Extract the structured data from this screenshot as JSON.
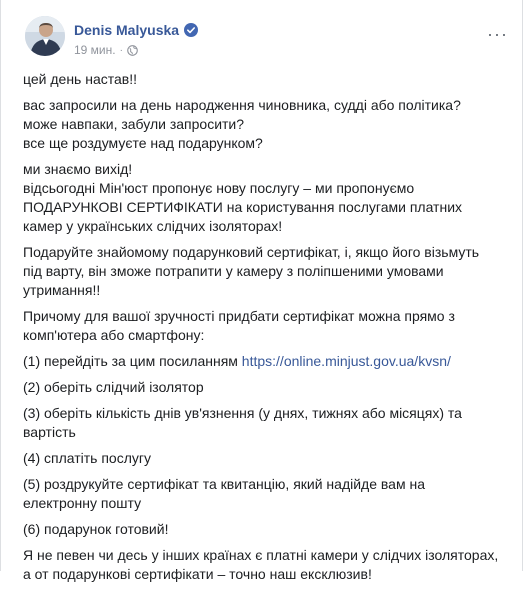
{
  "post": {
    "author": "Denis Malyuska",
    "time": "19 мин.",
    "more_label": "···",
    "paragraphs": [
      [
        "цей день настав!!"
      ],
      [
        "вас запросили на день народження чиновника, судді або політика?",
        "може навпаки, забули запросити?",
        "все ще роздумуєте над подарунком?"
      ],
      [
        "ми знаємо вихід!",
        "відсьогодні Мін'юст пропонує нову послугу – ми пропонуємо",
        "ПОДАРУНКОВІ СЕРТИФІКАТИ на користування послугами платних",
        "камер у українських слідчих ізоляторах!"
      ],
      [
        "Подаруйте знайомому подарунковий сертифікат, і, якщо його візьмуть",
        "під варту, він зможе потрапити у камеру з поліпшеними умовами",
        "утримання!!"
      ],
      [
        "Причому для вашої зручності придбати сертифікат можна прямо з",
        "комп'ютера або смартфону:"
      ]
    ],
    "step1_text": "(1) перейдіть за цим посиланням ",
    "step1_link": "https://online.minjust.gov.ua/kvsn/",
    "steps": [
      [
        "(2) оберіть слідчий ізолятор"
      ],
      [
        "(3) оберіть кількість днів ув'язнення (у днях, тижнях або місяцях) та",
        "вартість"
      ],
      [
        "(4) сплатіть послугу"
      ],
      [
        "(5) роздрукуйте сертифікат та квитанцію, який надійде вам на",
        "електронну пошту"
      ],
      [
        "(6) подарунок готовий!"
      ],
      [
        "Я не певен чи десь у інших країнах є платні камери у слідчих ізоляторах,",
        "а от подарункові сертифікати – точно наш ексклюзив!"
      ]
    ]
  },
  "colors": {
    "link": "#385898",
    "text": "#1c1e21",
    "meta": "#90949c",
    "verified": "#4267b2"
  },
  "icons": {
    "verified": "verified-badge-icon",
    "globe": "globe-icon",
    "more": "more-options-icon"
  }
}
